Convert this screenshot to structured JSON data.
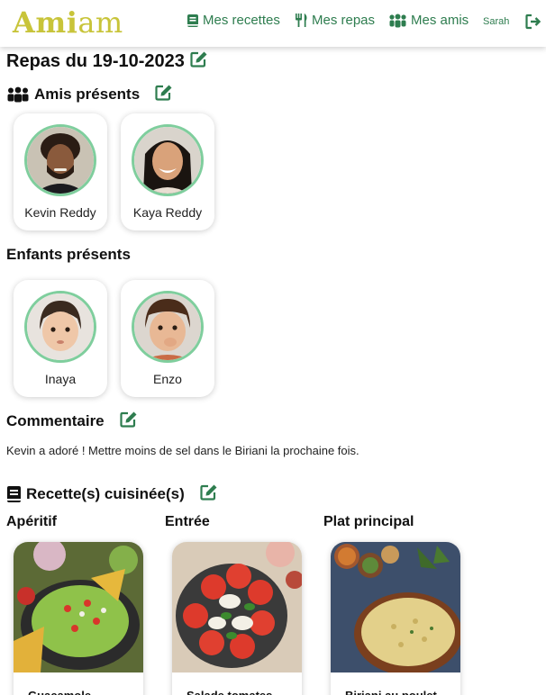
{
  "nav": {
    "brand_bold": "Ami",
    "brand_light": "am",
    "links": [
      {
        "label": "Mes recettes",
        "icon": "book-icon"
      },
      {
        "label": "Mes repas",
        "icon": "utensils-icon"
      },
      {
        "label": "Mes amis",
        "icon": "users-icon"
      }
    ],
    "user": "Sarah",
    "logout_icon": "logout-icon"
  },
  "page": {
    "title": "Repas du 19-10-2023"
  },
  "friends": {
    "heading": "Amis présents",
    "people": [
      {
        "name": "Kevin Reddy"
      },
      {
        "name": "Kaya Reddy"
      }
    ]
  },
  "children": {
    "heading": "Enfants présents",
    "people": [
      {
        "name": "Inaya"
      },
      {
        "name": "Enzo"
      }
    ]
  },
  "comment": {
    "heading": "Commentaire",
    "text": "Kevin a adoré ! Mettre moins de sel dans le Biriani la prochaine fois."
  },
  "recipes": {
    "heading": "Recette(s) cuisinée(s)",
    "columns": [
      {
        "category": "Apéritif",
        "name": "Guacamole"
      },
      {
        "category": "Entrée",
        "name": "Salade tomates"
      },
      {
        "category": "Plat principal",
        "name": "Biriani au poulet"
      }
    ]
  },
  "colors": {
    "accent_green": "#2e7d4f",
    "brand_yellow": "#c8c43a",
    "avatar_ring": "#7fce9d"
  }
}
